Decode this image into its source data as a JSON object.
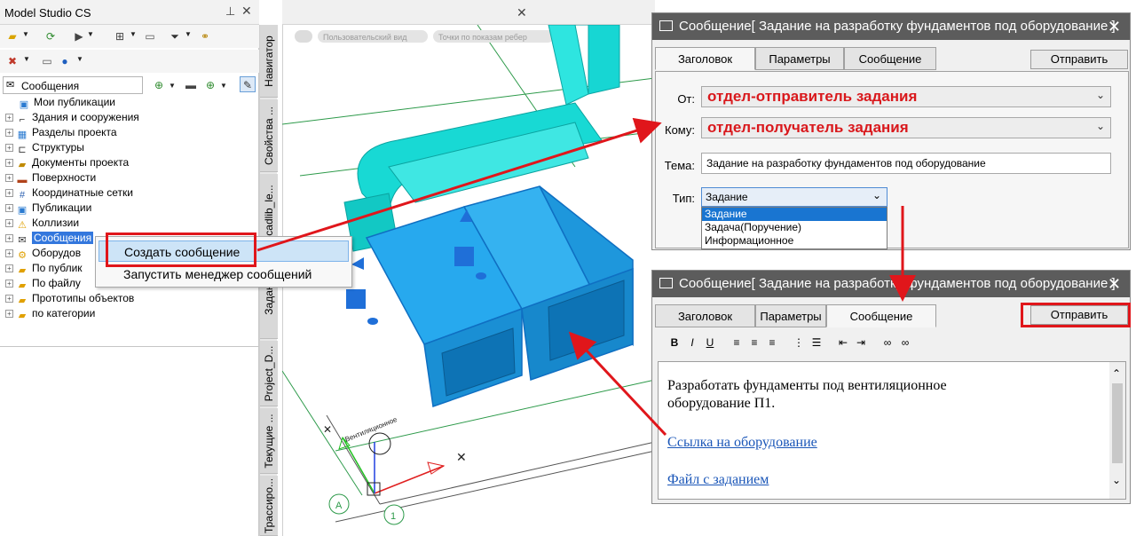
{
  "left_panel": {
    "title": "Model Studio CS",
    "pin_glyph": "⊥",
    "close_glyph": "✕",
    "search_value": "Сообщения",
    "tree": [
      {
        "label": "Мои публикации",
        "icon": "publication-icon",
        "expand": false
      },
      {
        "label": "Здания и сооружения",
        "icon": "building-icon",
        "expand": true
      },
      {
        "label": "Разделы проекта",
        "icon": "sections-icon",
        "expand": true
      },
      {
        "label": "Структуры",
        "icon": "structure-icon",
        "expand": true
      },
      {
        "label": "Документы проекта",
        "icon": "documents-icon",
        "expand": true
      },
      {
        "label": "Поверхности",
        "icon": "surface-icon",
        "expand": true
      },
      {
        "label": "Координатные сетки",
        "icon": "grid-icon",
        "expand": true
      },
      {
        "label": "Публикации",
        "icon": "publications-icon",
        "expand": true
      },
      {
        "label": "Коллизии",
        "icon": "warning-icon",
        "expand": true
      },
      {
        "label": "Сообщения",
        "icon": "envelope-icon",
        "expand": true,
        "selected": true
      },
      {
        "label": "Оборудов",
        "icon": "equipment-icon",
        "expand": true
      },
      {
        "label": "По публик",
        "icon": "folder-icon",
        "expand": true
      },
      {
        "label": "По файлу",
        "icon": "folder-icon",
        "expand": true
      },
      {
        "label": "Прототипы объектов",
        "icon": "folder-icon",
        "expand": true
      },
      {
        "label": "по категории",
        "icon": "folder-icon",
        "expand": true
      }
    ]
  },
  "vertical_tabs": [
    "Навигатор",
    "Свойства ...",
    "cadlib_le...",
    "Задания",
    "Project_D...",
    "Текущие ...",
    "Трассиро..."
  ],
  "viewport": {
    "close_glyph": "✕",
    "pill1": "Пользовательский вид",
    "pill2": "Точки по показам ребер",
    "label_axis": "Вентиляционное",
    "grid_a": "А",
    "grid_1": "1"
  },
  "context_menu": {
    "items": [
      "Создать сообщение",
      "Запустить менеджер сообщений"
    ]
  },
  "dialog1": {
    "title": "Сообщение[ Задание на разработку фундаментов под оборудование ]",
    "tabs": [
      "Заголовок",
      "Параметры",
      "Сообщение"
    ],
    "send": "Отправить",
    "from_label": "От:",
    "from_value": "отдел-отправитель задания",
    "to_label": "Кому:",
    "to_value": "отдел-получатель задания",
    "subject_label": "Тема:",
    "subject_value": "Задание на разработку фундаментов под оборудование",
    "type_label": "Тип:",
    "type_value": "Задание",
    "type_options": [
      "Задание",
      "Задача(Поручение)",
      "Информационное"
    ]
  },
  "dialog2": {
    "title": "Сообщение[ Задание на разработку фундаментов под оборудование ]",
    "tabs": [
      "Заголовок",
      "Параметры",
      "Сообщение"
    ],
    "send": "Отправить",
    "format_buttons": [
      "B",
      "I",
      "U"
    ],
    "body_line1": "Разработать фундаменты под вентиляционное",
    "body_line2": "оборудование П1.",
    "link1": "Ссылка на оборудование",
    "link2": "Файл с заданием"
  }
}
